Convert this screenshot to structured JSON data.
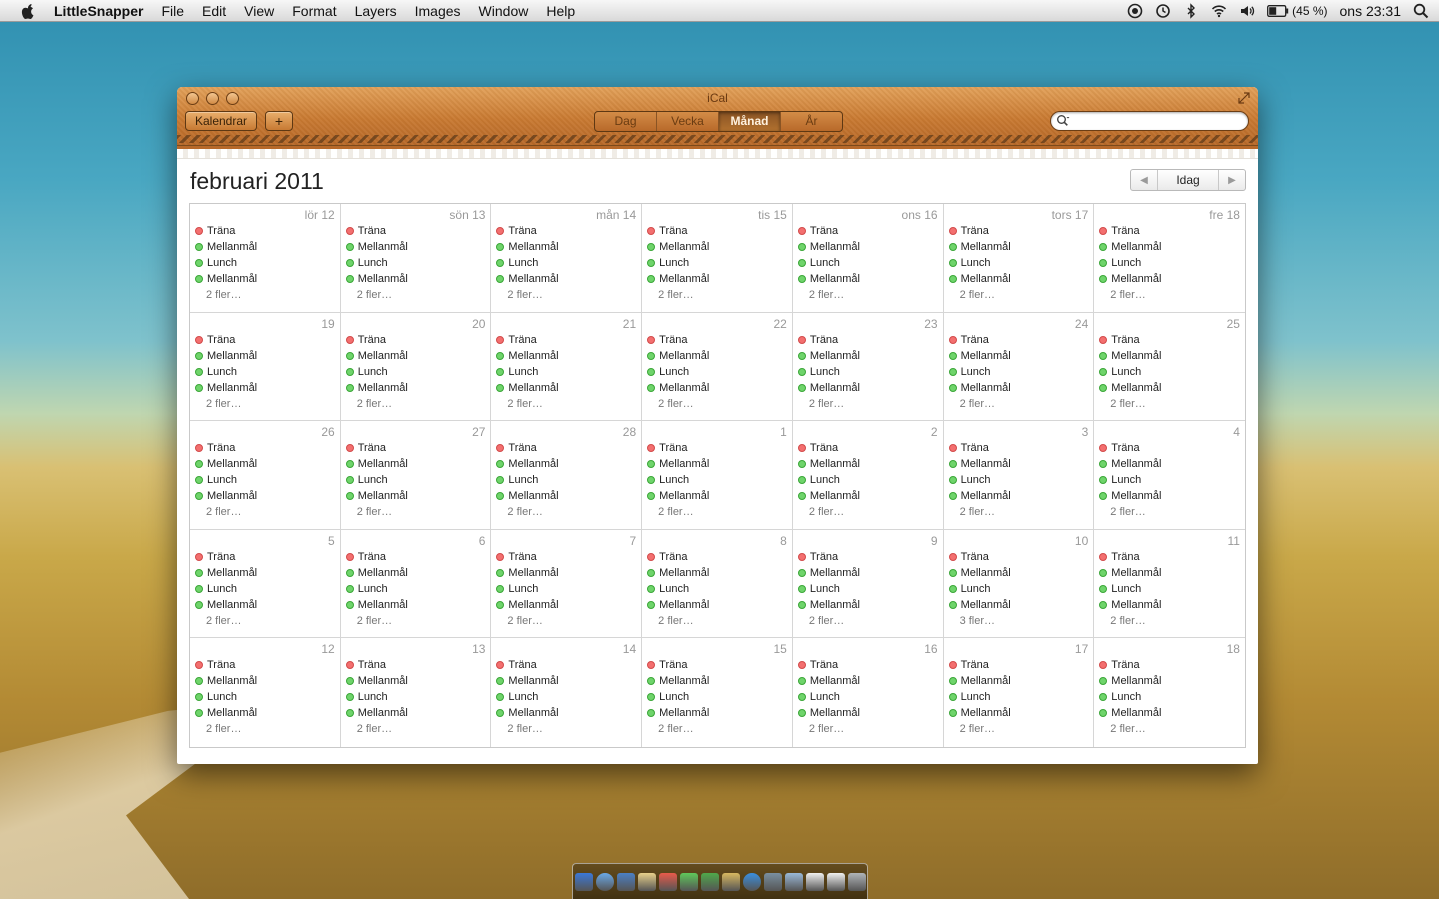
{
  "menubar": {
    "app_name": "LittleSnapper",
    "items": [
      "File",
      "Edit",
      "View",
      "Format",
      "Layers",
      "Images",
      "Window",
      "Help"
    ],
    "battery": "(45 %)",
    "clock": "ons 23:31"
  },
  "window": {
    "title": "iCal",
    "calendars_button": "Kalendrar",
    "add_button": "+",
    "views": [
      "Dag",
      "Vecka",
      "Månad",
      "År"
    ],
    "active_view": "Månad",
    "search_placeholder": "",
    "month_title": "februari 2011",
    "today_button": "Idag"
  },
  "calendar": {
    "weeks": [
      [
        "lör 12",
        "sön 13",
        "mån 14",
        "tis 15",
        "ons 16",
        "tors 17",
        "fre 18"
      ],
      [
        "19",
        "20",
        "21",
        "22",
        "23",
        "24",
        "25"
      ],
      [
        "26",
        "27",
        "28",
        "1",
        "2",
        "3",
        "4"
      ],
      [
        "5",
        "6",
        "7",
        "8",
        "9",
        "10",
        "11"
      ],
      [
        "12",
        "13",
        "14",
        "15",
        "16",
        "17",
        "18"
      ]
    ],
    "events": [
      {
        "name": "Träna",
        "color": "#f36f6f"
      },
      {
        "name": "Mellanmål",
        "color": "#6fd46b"
      },
      {
        "name": "Lunch",
        "color": "#6fd46b"
      },
      {
        "name": "Mellanmål",
        "color": "#6fd46b"
      }
    ],
    "more": [
      [
        "2 fler…",
        "2 fler…",
        "2 fler…",
        "2 fler…",
        "2 fler…",
        "2 fler…",
        "2 fler…"
      ],
      [
        "2 fler…",
        "2 fler…",
        "2 fler…",
        "2 fler…",
        "2 fler…",
        "2 fler…",
        "2 fler…"
      ],
      [
        "2 fler…",
        "2 fler…",
        "2 fler…",
        "2 fler…",
        "2 fler…",
        "2 fler…",
        "2 fler…"
      ],
      [
        "2 fler…",
        "2 fler…",
        "2 fler…",
        "2 fler…",
        "2 fler…",
        "3 fler…",
        "2 fler…"
      ],
      [
        "2 fler…",
        "2 fler…",
        "2 fler…",
        "2 fler…",
        "2 fler…",
        "2 fler…",
        "2 fler…"
      ]
    ]
  },
  "dock": {
    "icons": [
      "finder-icon",
      "safari-icon",
      "preview-icon",
      "notes-icon",
      "ical-icon",
      "messages-icon",
      "littlesnapper-icon",
      "books-icon",
      "itunes-icon",
      "system-preferences-icon",
      "folder-icon",
      "document-icon",
      "document-icon",
      "trash-icon"
    ],
    "colors": [
      "#3b78d8",
      "#6aa9e8",
      "#4b7fc4",
      "#e8d08a",
      "#e85a4a",
      "#5fc85a",
      "#4fa94a",
      "#d8b860",
      "#3a8fe0",
      "#7a8fa0",
      "#9ab9d8",
      "#f0f0f0",
      "#f0f0f0",
      "#b0b4b8"
    ]
  }
}
